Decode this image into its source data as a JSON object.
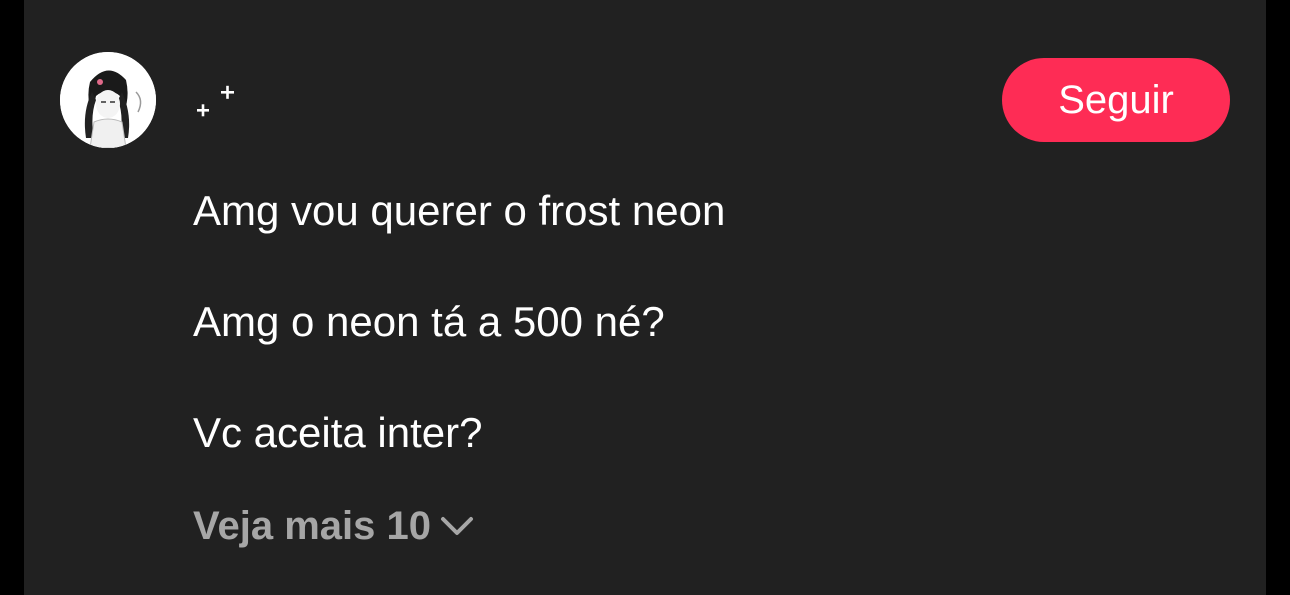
{
  "author": {
    "display_name": "₊⁺",
    "avatar_icon": "anime-girl-avatar-icon"
  },
  "follow_button": {
    "label": "Seguir",
    "color": "#fe2c55"
  },
  "messages": [
    "Amg vou querer o frost neon",
    "Amg o neon tá a 500 né?",
    "Vc aceita inter?"
  ],
  "see_more": {
    "label": "Veja mais 10",
    "icon": "chevron-down-icon"
  },
  "colors": {
    "background": "#212121",
    "text": "#ffffff",
    "muted": "#a6a6a6"
  }
}
